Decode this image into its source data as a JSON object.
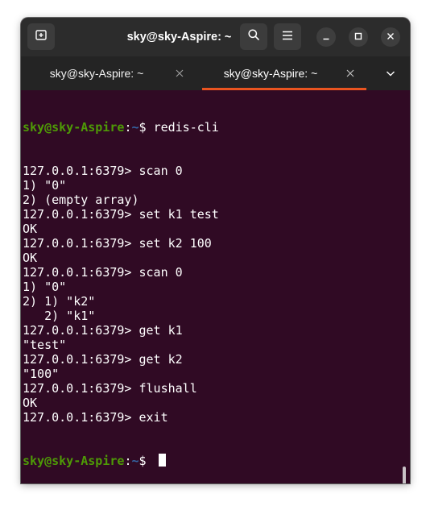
{
  "window": {
    "title": "sky@sky-Aspire: ~"
  },
  "header_buttons": {
    "new_tab": "new-tab-icon",
    "search": "search-icon",
    "menu": "hamburger-menu-icon",
    "minimize": "minimize-icon",
    "maximize": "maximize-icon",
    "close": "close-icon"
  },
  "tabs": [
    {
      "label": "sky@sky-Aspire: ~",
      "active": false
    },
    {
      "label": "sky@sky-Aspire: ~",
      "active": true
    }
  ],
  "colors": {
    "terminal_bg": "#300a24",
    "prompt_user": "#4e9a06",
    "prompt_path": "#3465a4",
    "tab_accent": "#e95420",
    "titlebar_bg": "#2c2c2c"
  },
  "prompt": {
    "user_host": "sky@sky-Aspire",
    "colon": ":",
    "path": "~",
    "symbol": "$ "
  },
  "first_command": "redis-cli",
  "output_lines": [
    "127.0.0.1:6379> scan 0",
    "1) \"0\"",
    "2) (empty array)",
    "127.0.0.1:6379> set k1 test",
    "OK",
    "127.0.0.1:6379> set k2 100",
    "OK",
    "127.0.0.1:6379> scan 0",
    "1) \"0\"",
    "2) 1) \"k2\"",
    "   2) \"k1\"",
    "127.0.0.1:6379> get k1",
    "\"test\"",
    "127.0.0.1:6379> get k2",
    "\"100\"",
    "127.0.0.1:6379> flushall",
    "OK",
    "127.0.0.1:6379> exit"
  ]
}
